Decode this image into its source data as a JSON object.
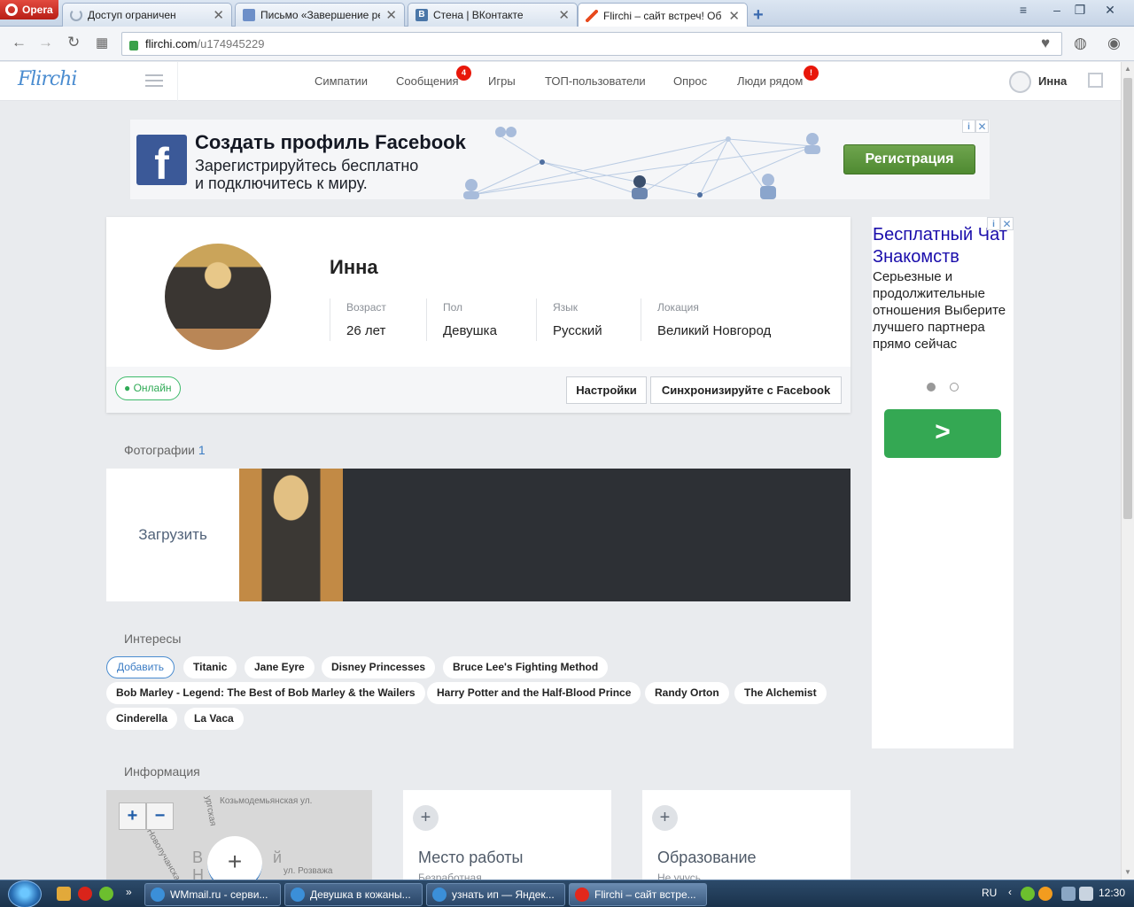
{
  "browser": {
    "menu_label": "Opera",
    "tabs": [
      {
        "title": "Доступ ограничен",
        "icon": "loading-spinner-icon"
      },
      {
        "title": "Письмо «Завершение ре",
        "icon": "mail-icon"
      },
      {
        "title": "Стена | ВКонтакте",
        "icon": "vk-icon"
      },
      {
        "title": "Flirchi – сайт встреч! Об",
        "icon": "flirchi-icon"
      }
    ],
    "url_domain": "flirchi.com",
    "url_path": "/u174945229"
  },
  "header": {
    "logo": "Flirchi",
    "menu": [
      {
        "label": "Симпатии"
      },
      {
        "label": "Сообщения",
        "badge": "4"
      },
      {
        "label": "Игры"
      },
      {
        "label": "ТОП-пользователи"
      },
      {
        "label": "Опрос"
      },
      {
        "label": "Люди рядом",
        "badge": "!"
      }
    ],
    "user_name": "Инна"
  },
  "fb_ad": {
    "title": "Создать профиль Facebook",
    "line1": "Зарегистрируйтесь бесплатно",
    "line2": "и подключитесь к миру.",
    "button": "Регистрация",
    "info": "i",
    "close": "✕"
  },
  "profile": {
    "name": "Инна",
    "fields": [
      {
        "label": "Возраст",
        "value": "26 лет"
      },
      {
        "label": "Пол",
        "value": "Девушка"
      },
      {
        "label": "Язык",
        "value": "Русский"
      },
      {
        "label": "Локация",
        "value": "Великий Новгород"
      }
    ],
    "status": "● Онлайн",
    "settings_button": "Настройки",
    "facebook_button": "Синхронизируйте с Facebook"
  },
  "side_ad": {
    "title": "Бесплатный Чат Знакомств",
    "text": "Серьезные и продолжительные отношения Выберите лучшего партнера прямо сейчас",
    "info": "i",
    "close": "✕"
  },
  "photos": {
    "title": "Фотографии",
    "count": "1",
    "upload_label": "Загрузить"
  },
  "interests": {
    "title": "Интересы",
    "add_label": "Добавить",
    "tags": [
      "Titanic",
      "Jane Eyre",
      "Disney Princesses",
      "Bruce Lee's Fighting Method",
      "Bob Marley - Legend: The Best of Bob Marley & the Wailers",
      "Harry Potter and the Half-Blood Prince",
      "Randy Orton",
      "The Alchemist",
      "Cinderella",
      "La Vaca"
    ]
  },
  "info": {
    "title": "Информация",
    "map": {
      "zoom_in": "+",
      "zoom_out": "−",
      "add": "+",
      "streets": [
        "Козьмодемьянская ул.",
        "ул. Розважа",
        "Новолучанская",
        "ургская"
      ],
      "city_letters": [
        "В",
        "й",
        "Н"
      ]
    },
    "work": {
      "title": "Место работы",
      "sub": "Безработная"
    },
    "education": {
      "title": "Образование",
      "sub": "Не учусь"
    }
  },
  "taskbar": {
    "tasks": [
      {
        "label": "WMmail.ru - серви..."
      },
      {
        "label": "Девушка в кожаны..."
      },
      {
        "label": "узнать ип — Яндек..."
      },
      {
        "label": "Flirchi – сайт встре..."
      }
    ],
    "lang": "RU",
    "time": "12:30"
  }
}
